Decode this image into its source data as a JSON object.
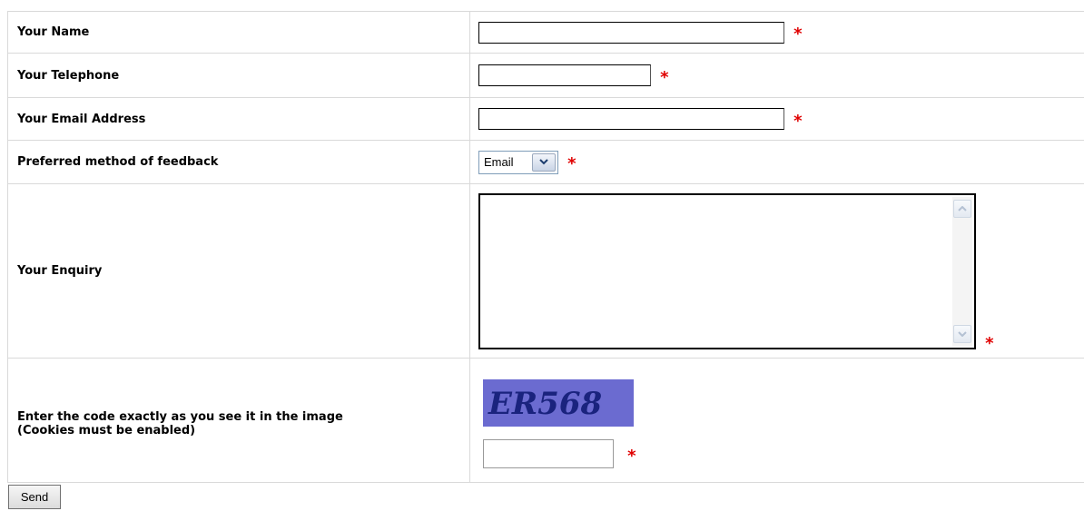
{
  "form": {
    "fields": {
      "name": {
        "label": "Your Name",
        "value": "",
        "required_marker": "*"
      },
      "telephone": {
        "label": "Your Telephone",
        "value": "",
        "required_marker": "*"
      },
      "email": {
        "label": "Your Email Address",
        "value": "",
        "required_marker": "*"
      },
      "feedback_method": {
        "label": "Preferred method of feedback",
        "selected": "Email",
        "required_marker": "*"
      },
      "enquiry": {
        "label": "Your Enquiry",
        "value": "",
        "required_marker": "*"
      },
      "captcha": {
        "label_line1": "Enter the code exactly as you see it in the image",
        "label_line2": "(Cookies must be enabled)",
        "code_image_text": "ER568",
        "value": "",
        "required_marker": "*"
      }
    },
    "submit_label": "Send"
  },
  "colors": {
    "required": "#e00000",
    "captcha_background": "#6b6bd0",
    "captcha_text": "#1a237e",
    "border": "#d9d9d9"
  },
  "icons": {
    "select_arrow": "chevron-down-icon",
    "scroll_up": "scroll-up-icon",
    "scroll_down": "scroll-down-icon"
  }
}
